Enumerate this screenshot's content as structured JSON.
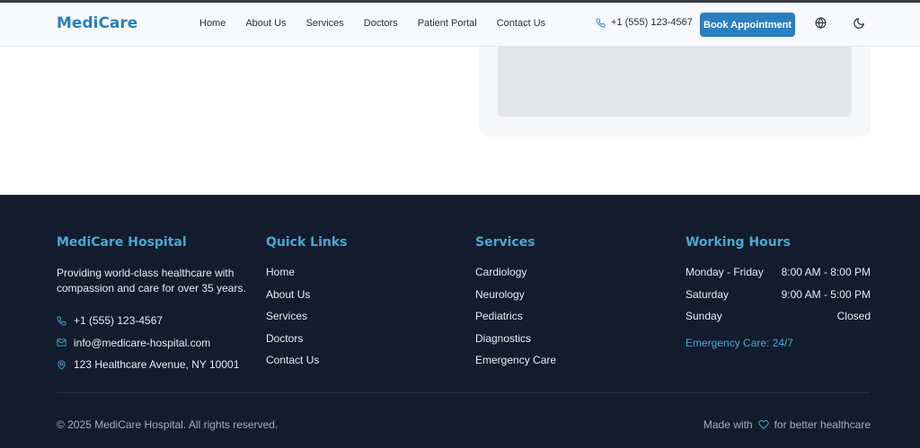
{
  "header": {
    "logo": "MediCare",
    "nav": [
      "Home",
      "About Us",
      "Services",
      "Doctors",
      "Patient Portal",
      "Contact Us"
    ],
    "phone": "+1 (555) 123-4567",
    "book_button": "Book Appointment",
    "icons": {
      "phone": "phone-icon",
      "language": "globe-icon",
      "theme": "moon-icon"
    }
  },
  "footer": {
    "about": {
      "title": "MediCare Hospital",
      "description": "Providing world-class healthcare with compassion and care for over 35 years.",
      "phone": "+1 (555) 123-4567",
      "email": "info@medicare-hospital.com",
      "address": "123 Healthcare Avenue, NY 10001"
    },
    "quick_links": {
      "title": "Quick Links",
      "items": [
        "Home",
        "About Us",
        "Services",
        "Doctors",
        "Contact Us"
      ]
    },
    "services": {
      "title": "Services",
      "items": [
        "Cardiology",
        "Neurology",
        "Pediatrics",
        "Diagnostics",
        "Emergency Care"
      ]
    },
    "hours": {
      "title": "Working Hours",
      "rows": [
        {
          "day": "Monday - Friday",
          "time": "8:00 AM - 8:00 PM"
        },
        {
          "day": "Saturday",
          "time": "9:00 AM - 5:00 PM"
        },
        {
          "day": "Sunday",
          "time": "Closed"
        }
      ],
      "emergency": "Emergency Care: 24/7"
    },
    "copyright": "© 2025 MediCare Hospital. All rights reserved.",
    "made_with_prefix": "Made with",
    "made_with_suffix": "for better healthcare"
  },
  "colors": {
    "brand": "#2a7fbf",
    "accent": "#4aa8cf",
    "footer_bg": "#131c2c"
  }
}
